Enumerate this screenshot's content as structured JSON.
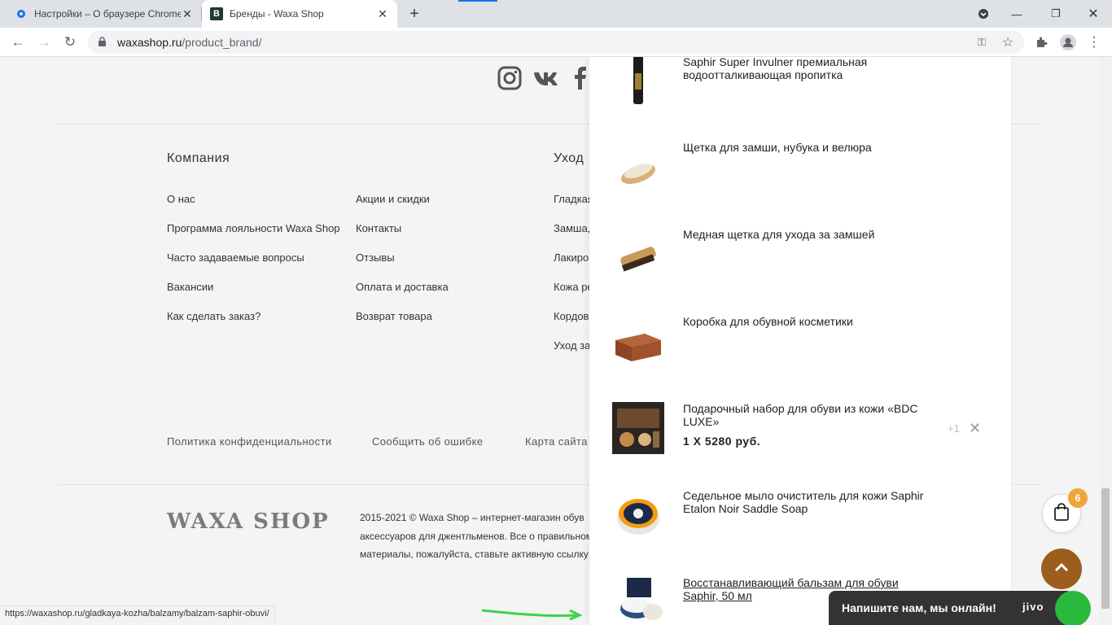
{
  "browser": {
    "tabs": [
      {
        "title": "Настройки – О браузере Chrome",
        "icon": "settings-gear-icon"
      },
      {
        "title": "Бренды - Waxa Shop",
        "icon": "waxa-favicon",
        "favicon_letter": "B"
      }
    ],
    "url_host": "waxashop.ru",
    "url_path": "/product_brand/",
    "status_url": "https://waxashop.ru/gladkaya-kozha/balzamy/balzam-saphir-obuvi/"
  },
  "footer": {
    "company_heading": "Компания",
    "care_heading": "Уход",
    "col1": [
      "О нас",
      "Программа лояльности Waxa Shop",
      "Часто задаваемые вопросы",
      "Вакансии",
      "Как сделать заказ?"
    ],
    "col2": [
      "Акции и скидки",
      "Контакты",
      "Отзывы",
      "Оплата и доставка",
      "Возврат товара"
    ],
    "col3": [
      "Гладкая",
      "Замша,",
      "Лакиро",
      "Кожа ре",
      "Кордов",
      "Уход за"
    ],
    "bottom_links": [
      "Политика конфиденциальности",
      "Сообщить об ошибке",
      "Карта сайта"
    ],
    "logo": "WAXA SHOP",
    "copyright_lines": [
      "2015-2021 © Waxa Shop – интернет-магазин обув",
      "аксессуаров для джентльменов. Все о правильном",
      "материалы, пожалуйста, ставьте активную ссылку"
    ]
  },
  "cart": {
    "items": [
      {
        "name": "Saphir Super Invulner премиальная водоотталкивающая пропитка",
        "qty_text": "",
        "thumb": "spray-can"
      },
      {
        "name": "Щетка для замши, нубука и велюра",
        "qty_text": "",
        "thumb": "suede-brush"
      },
      {
        "name": "Медная щетка для ухода за замшей",
        "qty_text": "",
        "thumb": "copper-brush"
      },
      {
        "name": "Коробка для обувной косметики",
        "qty_text": "",
        "thumb": "wooden-box"
      },
      {
        "name": "Подарочный набор для обуви из кожи «BDC LUXE»",
        "qty_text": "1 X 5280 руб.",
        "thumb": "gift-set",
        "plus": "+1"
      },
      {
        "name": "Седельное мыло очиститель для кожи Saphir Etalon Noir Saddle Soap",
        "qty_text": "",
        "thumb": "saddle-soap"
      },
      {
        "name": "Восстанавливающий бальзам для обуви Saphir, 50 мл",
        "qty_text": "",
        "thumb": "balm-jar"
      }
    ],
    "badge_count": "6"
  },
  "chat": {
    "label": "Напишите нам, мы онлайн!",
    "brand": "jivo"
  },
  "colors": {
    "accent_brown": "#9c5d1e",
    "badge_orange": "#f0a53a",
    "jivo_green": "#2ab93c"
  }
}
